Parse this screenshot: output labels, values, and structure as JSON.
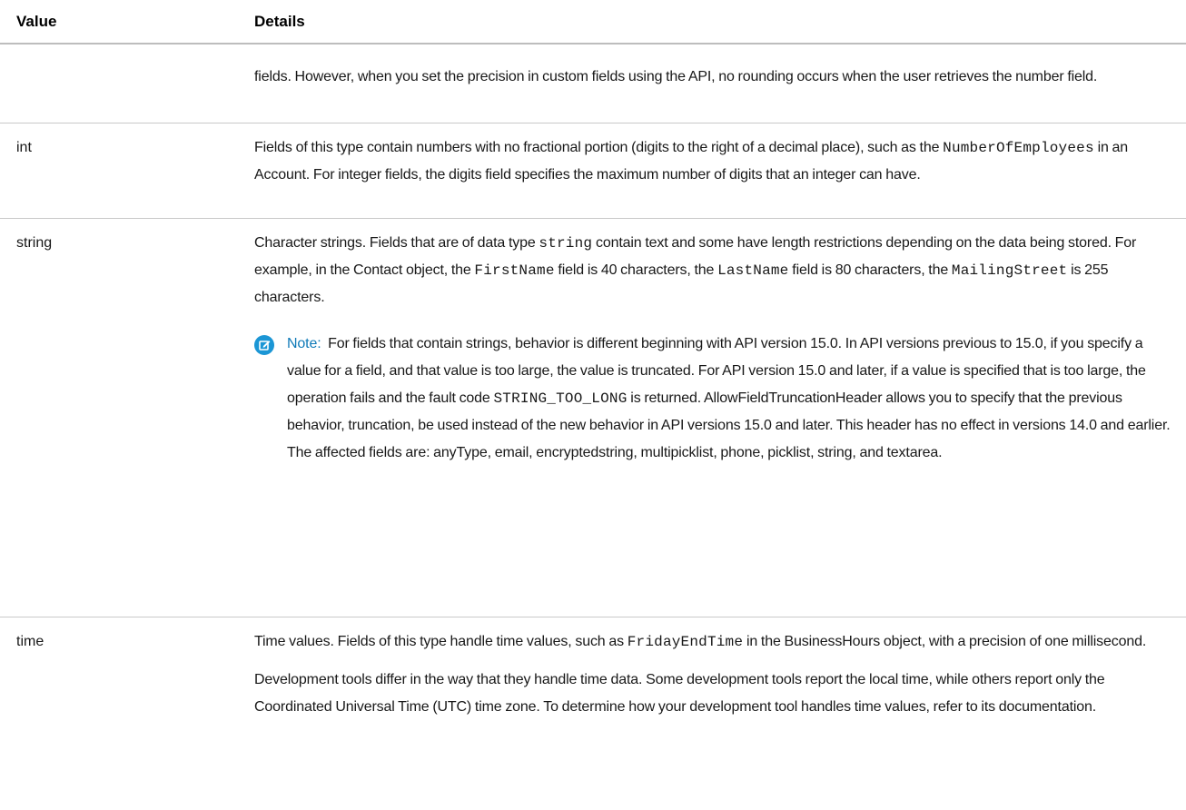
{
  "header": {
    "value_label": "Value",
    "details_label": "Details"
  },
  "rows": [
    {
      "value": "",
      "paragraphs": [
        "fields. However, when you set the precision in custom fields using the API, no rounding occurs when the user retrieves the number field."
      ]
    },
    {
      "value": "int",
      "paragraphs": [
        "Fields of this type contain numbers with no fractional portion (digits to the right of a decimal place), such as the NumberOfEmployees in an Account. For integer fields, the digits field specifies the maximum number of digits that an integer can have."
      ],
      "code": [
        "NumberOfEmployees"
      ]
    },
    {
      "value": "string",
      "paragraphs": [
        "Character strings. Fields that are of data type string contain text and some have length restrictions depending on the data being stored. For example, in the Contact object, the FirstName field is 40 characters, the LastName field is 80 characters, the MailingStreet is 255 characters."
      ],
      "code": [
        "string",
        "FirstName",
        "LastName",
        "MailingStreet",
        "STRING_TOO_LONG"
      ],
      "note": {
        "label": "Note:",
        "text": "For fields that contain strings, behavior is different beginning with API version 15.0. In API versions previous to 15.0, if you specify a value for a field, and that value is too large, the value is truncated. For API version 15.0 and later, if a value is specified that is too large, the operation fails and the fault code STRING_TOO_LONG is returned. AllowFieldTruncationHeader allows you to specify that the previous behavior, truncation, be used instead of the new behavior in API versions 15.0 and later. This header has no effect in versions 14.0 and earlier. The affected fields are: anyType, email, encryptedstring, multipicklist, phone, picklist, string, and textarea.",
        "icon": "edit-note-icon",
        "icon_color": "#1b96d5"
      }
    },
    {
      "value": "time",
      "paragraphs": [
        "Time values. Fields of this type handle time values, such as FridayEndTime in the BusinessHours object, with a precision of one millisecond.",
        "Development tools differ in the way that they handle time data. Some development tools report the local time, while others report only the Coordinated Universal Time (UTC) time zone. To determine how your development tool handles time values, refer to its documentation."
      ],
      "code": [
        "FridayEndTime"
      ]
    }
  ]
}
